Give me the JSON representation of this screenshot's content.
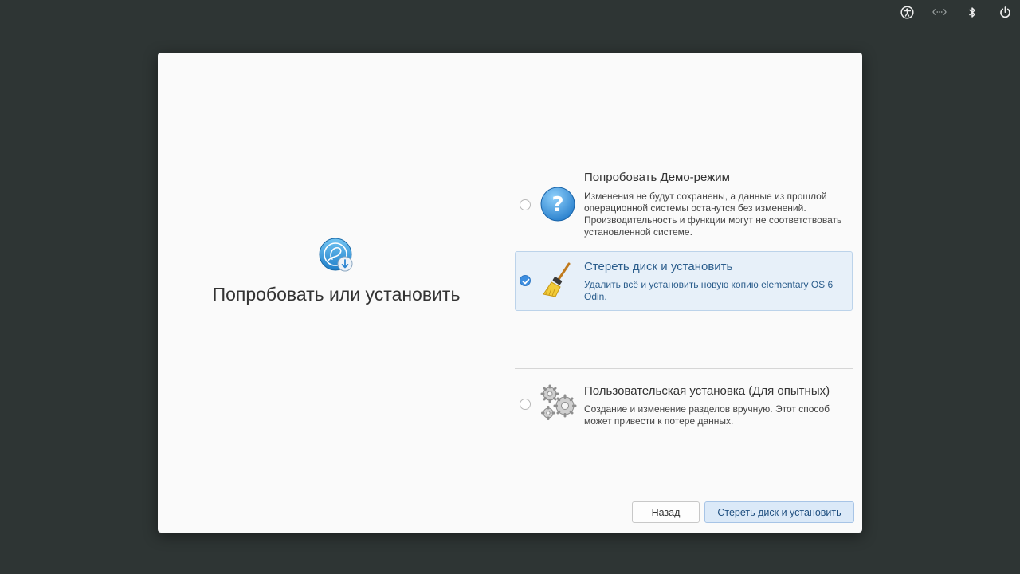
{
  "panel": {
    "icons": [
      "accessibility-icon",
      "network-icon",
      "bluetooth-icon",
      "power-icon"
    ]
  },
  "dialog": {
    "title": "Попробовать или установить",
    "logo": "elementary-installer-icon"
  },
  "options": [
    {
      "icon": "question-icon",
      "title": "Попробовать Демо-режим",
      "description": "Изменения не будут сохранены, а данные из прошлой операционной системы останутся без изменений. Производительность и функции могут не соответствовать установленной системе.",
      "selected": false
    },
    {
      "icon": "broom-icon",
      "title": "Стереть диск и установить",
      "description": "Удалить всё и установить новую копию elementary OS 6 Odin.",
      "selected": true
    },
    {
      "icon": "gears-icon",
      "title": "Пользовательская установка (Для опытных)",
      "description": "Создание и изменение разделов вручную. Этот способ может привести к потере данных.",
      "selected": false
    }
  ],
  "buttons": {
    "back": "Назад",
    "next": "Стереть диск и установить"
  },
  "colors": {
    "desktop": "#2e3534",
    "accent": "#3d8ee0",
    "selected_bg": "#e7f0f9"
  }
}
